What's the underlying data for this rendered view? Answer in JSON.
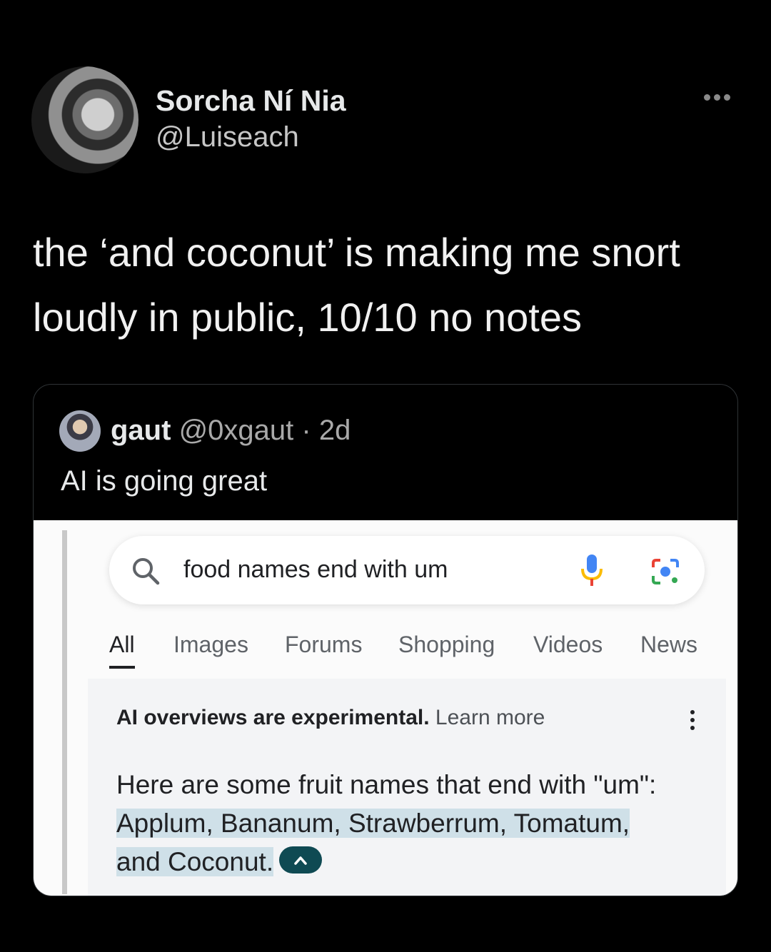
{
  "tweet": {
    "author_name": "Sorcha Ní Nia",
    "author_handle": "@Luiseach",
    "text_line1": "the ‘and coconut’ is making me snort",
    "text_line2": "loudly in public, 10/10 no notes"
  },
  "quoted": {
    "name": "gaut",
    "handle": "@0xgaut",
    "time": "2d",
    "text": "AI is going great"
  },
  "google": {
    "query": "food names end with um",
    "tabs": [
      "All",
      "Images",
      "Forums",
      "Shopping",
      "Videos",
      "News"
    ],
    "active_tab": "All",
    "ai_notice": "AI overviews are experimental.",
    "learn_more": "Learn more",
    "answer_intro": "Here are some fruit names that end with \"um\":",
    "answer_highlight_line1": "Applum, Bananum, Strawberrum, Tomatum,",
    "answer_highlight_line2": "and Coconut."
  },
  "colors": {
    "background": "#000000",
    "highlight": "#cfe0e8",
    "collapse_button": "#0f4a53",
    "mic_blue": "#4285f4",
    "mic_red": "#ea4335"
  },
  "icons": [
    "more-icon",
    "search-icon",
    "mic-icon",
    "lens-icon",
    "kebab-icon",
    "chevron-up-icon"
  ]
}
